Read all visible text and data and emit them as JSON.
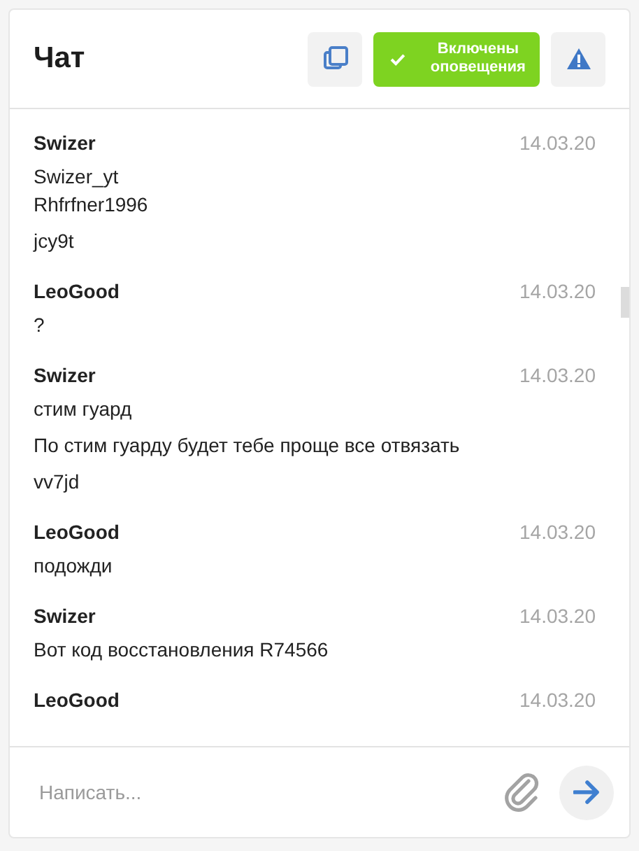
{
  "header": {
    "title": "Чат",
    "notifications": {
      "label": "Включены оповещения",
      "on": true
    }
  },
  "messages": [
    {
      "author": "Swizer",
      "date": "14.03.20",
      "paragraphs": [
        "Swizer_yt\nRhfrfner1996",
        "jcy9t"
      ]
    },
    {
      "author": "LeoGood",
      "date": "14.03.20",
      "paragraphs": [
        "?"
      ]
    },
    {
      "author": "Swizer",
      "date": "14.03.20",
      "paragraphs": [
        "стим гуард",
        "По стим гуарду будет тебе проще все отвязать",
        "vv7jd"
      ]
    },
    {
      "author": "LeoGood",
      "date": "14.03.20",
      "paragraphs": [
        "подожди"
      ]
    },
    {
      "author": "Swizer",
      "date": "14.03.20",
      "paragraphs": [
        "Вот код восстановления R74566"
      ]
    },
    {
      "author": "LeoGood",
      "date": "14.03.20"
    }
  ],
  "composer": {
    "placeholder": "Написать..."
  }
}
